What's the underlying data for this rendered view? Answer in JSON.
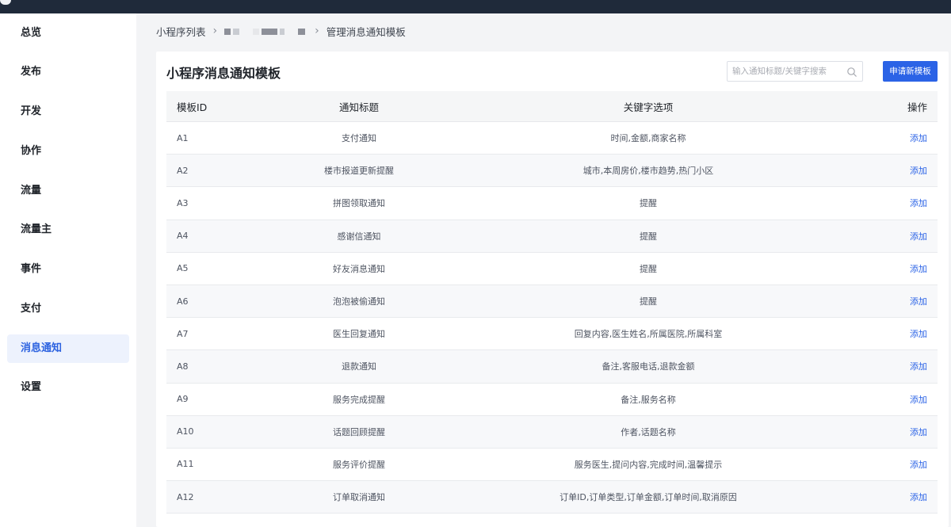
{
  "sidebar": {
    "items": [
      {
        "label": "总览"
      },
      {
        "label": "发布"
      },
      {
        "label": "开发"
      },
      {
        "label": "协作"
      },
      {
        "label": "流量"
      },
      {
        "label": "流量主"
      },
      {
        "label": "事件"
      },
      {
        "label": "支付"
      },
      {
        "label": "消息通知",
        "active": true
      },
      {
        "label": "设置"
      }
    ]
  },
  "breadcrumb": {
    "root": "小程序列表",
    "current": "管理消息通知模板"
  },
  "card": {
    "title": "小程序消息通知模板"
  },
  "search": {
    "placeholder": "输入通知标题/关键字搜索",
    "value": ""
  },
  "actions": {
    "apply_label": "申请新模板"
  },
  "table": {
    "headers": {
      "id": "模板ID",
      "title": "通知标题",
      "keywords": "关键字选项",
      "op": "操作"
    },
    "op_label": "添加",
    "rows": [
      {
        "id": "A1",
        "title": "支付通知",
        "keywords": "时间,金额,商家名称"
      },
      {
        "id": "A2",
        "title": "楼市报道更新提醒",
        "keywords": "城市,本周房价,楼市趋势,热门小区"
      },
      {
        "id": "A3",
        "title": "拼图领取通知",
        "keywords": "提醒"
      },
      {
        "id": "A4",
        "title": "感谢信通知",
        "keywords": "提醒"
      },
      {
        "id": "A5",
        "title": "好友消息通知",
        "keywords": "提醒"
      },
      {
        "id": "A6",
        "title": "泡泡被偷通知",
        "keywords": "提醒"
      },
      {
        "id": "A7",
        "title": "医生回复通知",
        "keywords": "回复内容,医生姓名,所属医院,所属科室"
      },
      {
        "id": "A8",
        "title": "退款通知",
        "keywords": "备注,客服电话,退款金额"
      },
      {
        "id": "A9",
        "title": "服务完成提醒",
        "keywords": "备注,服务名称"
      },
      {
        "id": "A10",
        "title": "话题回顾提醒",
        "keywords": "作者,话题名称"
      },
      {
        "id": "A11",
        "title": "服务评价提醒",
        "keywords": "服务医生,提问内容,完成时间,温馨提示"
      },
      {
        "id": "A12",
        "title": "订单取消通知",
        "keywords": "订单ID,订单类型,订单金额,订单时间,取消原因"
      }
    ]
  },
  "colors": {
    "accent": "#2b63e6",
    "active_bg": "#edf2fd",
    "topbar": "#1f2a3a"
  },
  "icons": {
    "search": "search-icon",
    "breadcrumb_sep": "chevron-right-icon"
  }
}
